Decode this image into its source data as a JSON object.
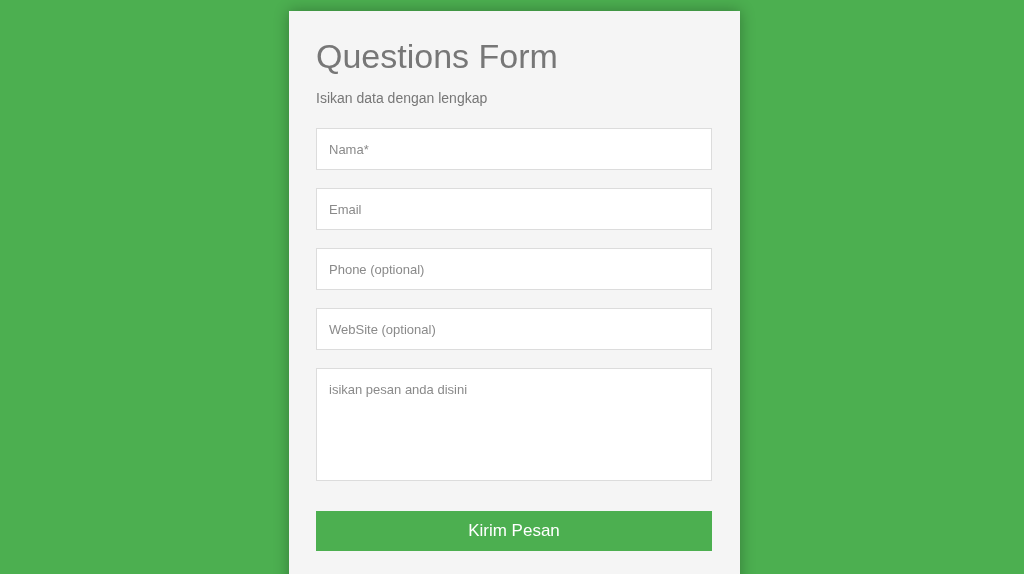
{
  "form": {
    "title": "Questions Form",
    "subtitle": "Isikan data dengan lengkap",
    "fields": [
      {
        "kind": "input",
        "placeholder": "Nama*"
      },
      {
        "kind": "input",
        "placeholder": "Email"
      },
      {
        "kind": "input",
        "placeholder": "Phone (optional)"
      },
      {
        "kind": "input",
        "placeholder": "WebSite (optional)"
      },
      {
        "kind": "textarea",
        "placeholder": "isikan pesan anda disini"
      }
    ],
    "submit": "Kirim Pesan"
  }
}
